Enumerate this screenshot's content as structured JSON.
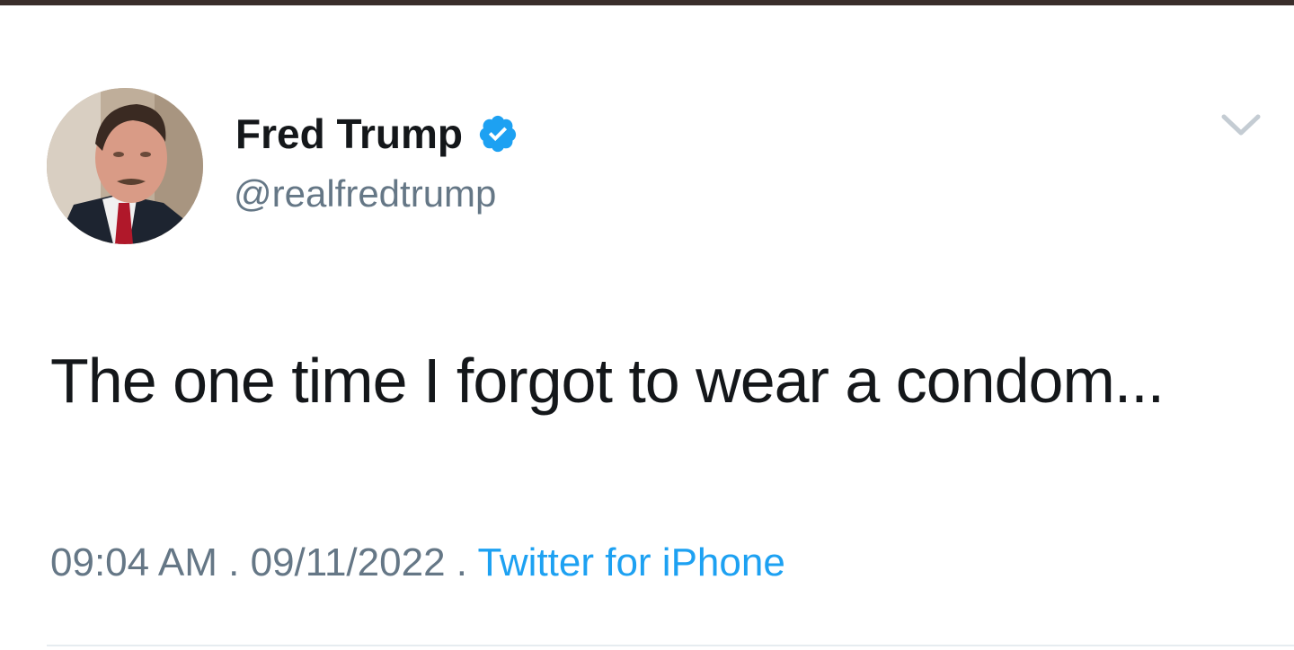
{
  "tweet": {
    "author_name": "Fred Trump",
    "author_handle": "@realfredtrump",
    "verified": true,
    "avatar_icon": "profile-photo",
    "text": "The one time I forgot to wear a condom...",
    "time": "09:04 AM",
    "separator_1": " . ",
    "date": "09/11/2022",
    "separator_2": " . ",
    "source": "Twitter for iPhone"
  },
  "colors": {
    "verified_blue": "#1da1f2",
    "link_blue": "#1da1f2",
    "secondary_text": "#657786",
    "primary_text": "#14171a",
    "chevron": "#aab8c2"
  },
  "icons": {
    "verified": "verified-badge-icon",
    "more": "chevron-down-icon"
  }
}
